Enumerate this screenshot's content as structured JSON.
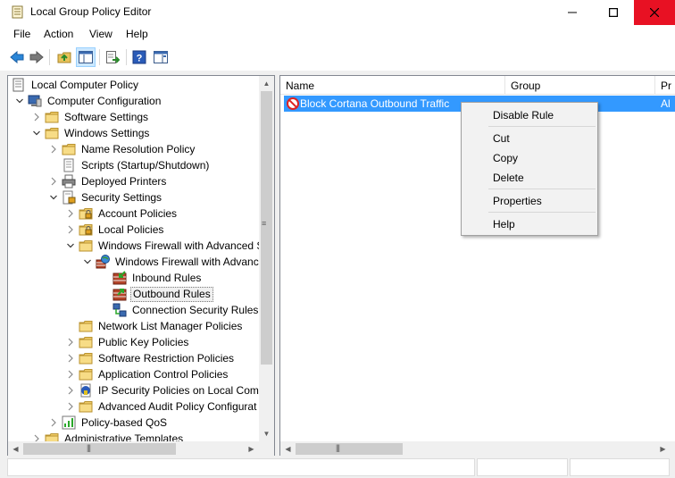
{
  "window": {
    "title": "Local Group Policy Editor",
    "close_color": "#e81123"
  },
  "menu": [
    "File",
    "Action",
    "View",
    "Help"
  ],
  "toolbar": {
    "buttons": [
      "back-icon",
      "forward-icon",
      "up-folder-icon",
      "show-hide-tree-icon",
      "export-list-icon",
      "help-icon",
      "properties-pane-icon"
    ]
  },
  "tree": {
    "items": [
      {
        "label": "Local Computer Policy",
        "icon": "computer-policy-icon",
        "expanded": true
      },
      {
        "label": "Computer Configuration",
        "icon": "computer-icon",
        "expanded": true
      },
      {
        "label": "Software Settings",
        "icon": "folder-icon",
        "expanded": false
      },
      {
        "label": "Windows Settings",
        "icon": "folder-icon",
        "expanded": true
      },
      {
        "label": "Name Resolution Policy",
        "icon": "folder-icon",
        "expanded": false
      },
      {
        "label": "Scripts (Startup/Shutdown)",
        "icon": "script-icon"
      },
      {
        "label": "Deployed Printers",
        "icon": "printer-icon",
        "expanded": false
      },
      {
        "label": "Security Settings",
        "icon": "security-icon",
        "expanded": true
      },
      {
        "label": "Account Policies",
        "icon": "locked-folder-icon",
        "expanded": false
      },
      {
        "label": "Local Policies",
        "icon": "locked-folder-icon",
        "expanded": false
      },
      {
        "label": "Windows Firewall with Advanced S",
        "icon": "folder-icon",
        "expanded": true
      },
      {
        "label": "Windows Firewall with Advanc",
        "icon": "firewall-globe-icon",
        "expanded": true
      },
      {
        "label": "Inbound Rules",
        "icon": "firewall-inbound-icon"
      },
      {
        "label": "Outbound Rules",
        "icon": "firewall-outbound-icon",
        "selected": true
      },
      {
        "label": "Connection Security Rules",
        "icon": "connection-security-icon"
      },
      {
        "label": "Network List Manager Policies",
        "icon": "folder-icon"
      },
      {
        "label": "Public Key Policies",
        "icon": "folder-icon",
        "expanded": false
      },
      {
        "label": "Software Restriction Policies",
        "icon": "folder-icon",
        "expanded": false
      },
      {
        "label": "Application Control Policies",
        "icon": "folder-icon",
        "expanded": false
      },
      {
        "label": "IP Security Policies on Local Comp",
        "icon": "ip-security-icon",
        "expanded": false
      },
      {
        "label": "Advanced Audit Policy Configurat",
        "icon": "folder-icon",
        "expanded": false
      },
      {
        "label": "Policy-based QoS",
        "icon": "qos-icon",
        "expanded": false
      },
      {
        "label": "Administrative Templates",
        "icon": "folder-icon",
        "expanded": false
      }
    ]
  },
  "list": {
    "columns": [
      "Name",
      "Group",
      "Pr"
    ],
    "rows": [
      {
        "name": "Block Cortana Outbound Traffic",
        "group": "",
        "profile": "Al",
        "icon": "block-icon"
      }
    ]
  },
  "context_menu": {
    "items": [
      "Disable Rule",
      "Cut",
      "Copy",
      "Delete",
      "Properties",
      "Help"
    ]
  }
}
